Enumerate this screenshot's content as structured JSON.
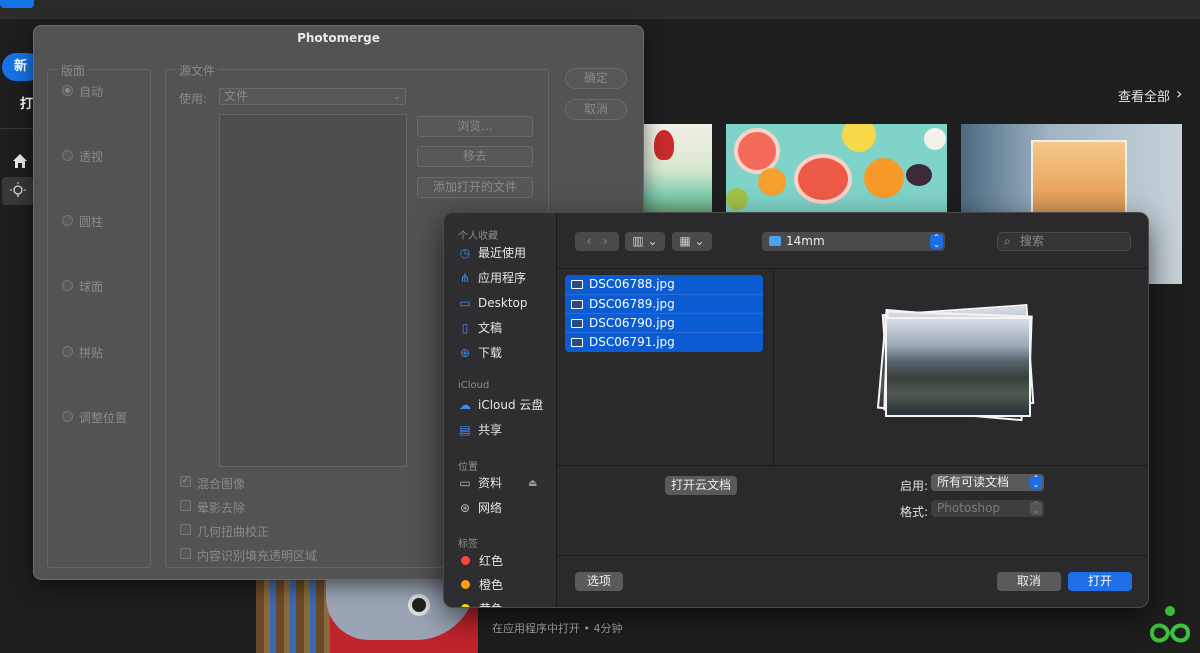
{
  "background": {
    "new_button": "新",
    "open_button": "打",
    "view_all": "查看全部",
    "opened_meta": "在应用程序中打开 • 4分钟"
  },
  "photomerge": {
    "title": "Photomerge",
    "layout": {
      "label": "版面",
      "options": [
        "自动",
        "透视",
        "圆柱",
        "球面",
        "拼贴",
        "调整位置"
      ],
      "selected": "自动"
    },
    "source": {
      "label": "源文件",
      "use_label": "使用:",
      "use_value": "文件",
      "browse": "浏览...",
      "remove": "移去",
      "add_open": "添加打开的文件"
    },
    "options": [
      {
        "label": "混合图像",
        "checked": true
      },
      {
        "label": "晕影去除",
        "checked": false
      },
      {
        "label": "几何扭曲校正",
        "checked": false
      },
      {
        "label": "内容识别填充透明区域",
        "checked": false
      }
    ],
    "ok": "确定",
    "cancel": "取消"
  },
  "open_dialog": {
    "sidebar": {
      "favorites_header": "个人收藏",
      "favorites": [
        {
          "label": "最近使用",
          "icon": "clock-icon"
        },
        {
          "label": "应用程序",
          "icon": "applications-icon"
        },
        {
          "label": "Desktop",
          "icon": "desktop-icon"
        },
        {
          "label": "文稿",
          "icon": "document-icon"
        },
        {
          "label": "下载",
          "icon": "download-icon"
        }
      ],
      "icloud_header": "iCloud",
      "icloud": [
        {
          "label": "iCloud 云盘",
          "icon": "cloud-icon"
        },
        {
          "label": "共享",
          "icon": "shared-folder-icon"
        }
      ],
      "locations_header": "位置",
      "locations": [
        {
          "label": "资料",
          "icon": "disk-icon"
        },
        {
          "label": "网络",
          "icon": "network-icon"
        }
      ],
      "tags_header": "标签",
      "tags": [
        {
          "label": "红色",
          "color": "#ff453a"
        },
        {
          "label": "橙色",
          "color": "#ff9f0a"
        },
        {
          "label": "黄色",
          "color": "#ffd60a"
        }
      ]
    },
    "path": "14mm",
    "search_placeholder": "搜索",
    "files": [
      "DSC06788.jpg",
      "DSC06789.jpg",
      "DSC06790.jpg",
      "DSC06791.jpg"
    ],
    "open_cloud": "打开云文档",
    "enable_label": "启用:",
    "enable_value": "所有可读文档",
    "format_label": "格式:",
    "format_value": "Photoshop",
    "options_button": "选项",
    "cancel_button": "取消",
    "open_button": "打开"
  }
}
